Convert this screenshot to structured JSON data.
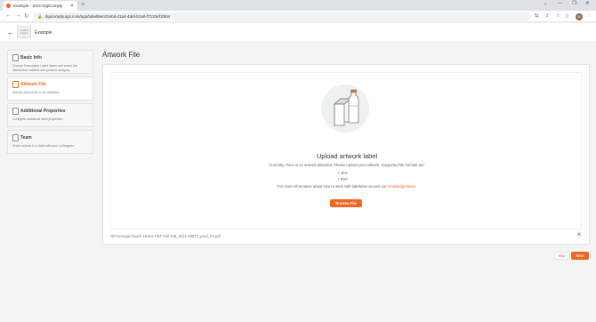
{
  "browser": {
    "tab_title": "Example - SGS DigiComply",
    "tab_close": "✕",
    "new_tab": "+",
    "url": "digicomply.sgs.com/app/label/6ec02ebd-41a4-4afd-b2a0-f7122ef1f504",
    "window_controls": [
      "⌄",
      "—",
      "❐",
      "✕"
    ],
    "profile_initial": "M",
    "nav": {
      "back": "←",
      "forward": "→",
      "reload": "↻"
    }
  },
  "app_header": {
    "back_arrow": "←",
    "placeholder_text": "no label artwork",
    "title": "Example"
  },
  "sidebar": {
    "items": [
      {
        "label": "Basic Info",
        "description": "Choose Descriptive Label Name and select the distribution markets and product category."
      },
      {
        "label": "Artwork File",
        "description": "Upload artwork file to be validated."
      },
      {
        "label": "Additional Properties",
        "description": "Configure additional label properties."
      },
      {
        "label": "Team",
        "description": "Share access to a label with your colleagues."
      }
    ]
  },
  "main": {
    "page_title": "Artwork File",
    "upload_title": "Upload artwork label",
    "upload_subtitle": "Currently, there is no artwork attached. Please upload your artwork. Supported file formats are:",
    "formats": [
      "JPG",
      "PDF"
    ],
    "info_prefix": "For more information about how to work with labelwise access our ",
    "knowledge_base": "Knowledge Base",
    "info_suffix": ".",
    "browse_label": "Browse File",
    "filename": "GP Georgia Peach 16.9oz PET Poll Pall_2021-00872_prod_#4.pdf",
    "file_close": "✕"
  },
  "footer": {
    "skip_label": "Skip",
    "next_label": "Next"
  },
  "colors": {
    "accent": "#f26522"
  }
}
